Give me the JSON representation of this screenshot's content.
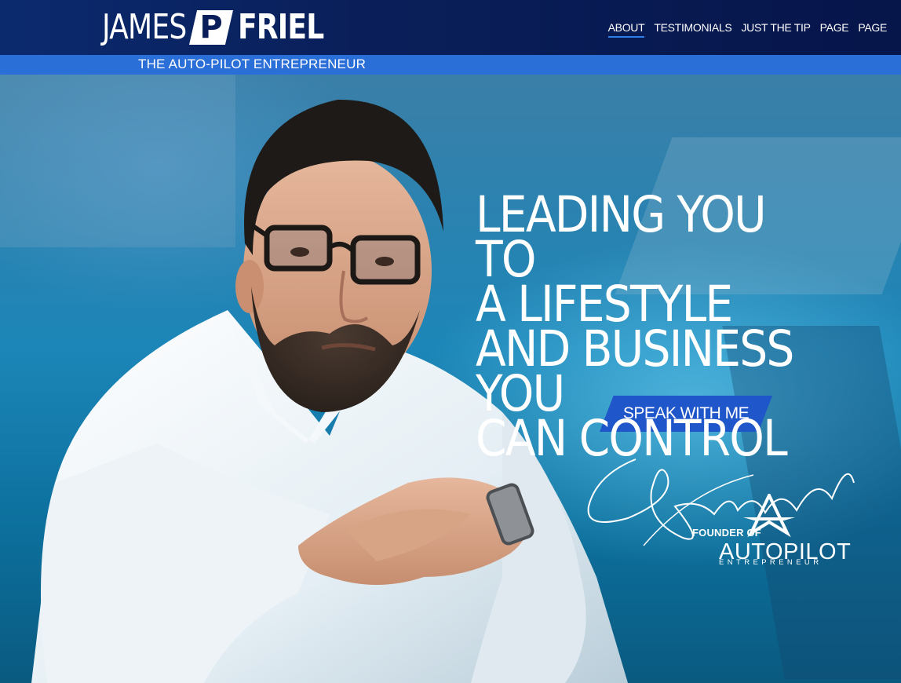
{
  "header": {
    "logo": {
      "first": "JAMES",
      "middle": "P",
      "last": "FRIEL"
    },
    "tagline": "THE AUTO-PILOT ENTREPRENEUR",
    "nav": [
      {
        "label": "ABOUT",
        "active": true
      },
      {
        "label": "TESTIMONIALS",
        "active": false
      },
      {
        "label": "JUST THE TIP",
        "active": false
      },
      {
        "label": "PAGE",
        "active": false
      },
      {
        "label": "PAGE",
        "active": false
      }
    ]
  },
  "hero": {
    "headline_lines": [
      "LEADING YOU",
      "TO",
      "A LIFESTYLE",
      "AND BUSINESS",
      "YOU",
      "CAN CONTROL"
    ],
    "cta_label": "SPEAK WITH ME",
    "founder_label": "FOUNDER OF",
    "brand_name": "AUTOPILOT",
    "brand_sub": "ENTREPRENEUR"
  },
  "colors": {
    "header_bg": "#0a1f5a",
    "tagline_bar": "#2a6ed8",
    "cta_bg": "#1f56c9",
    "nav_active_underline": "#2f7de8"
  },
  "icons": {
    "signature": "signature-icon",
    "autopilot_logo": "autopilot-logo-icon"
  }
}
